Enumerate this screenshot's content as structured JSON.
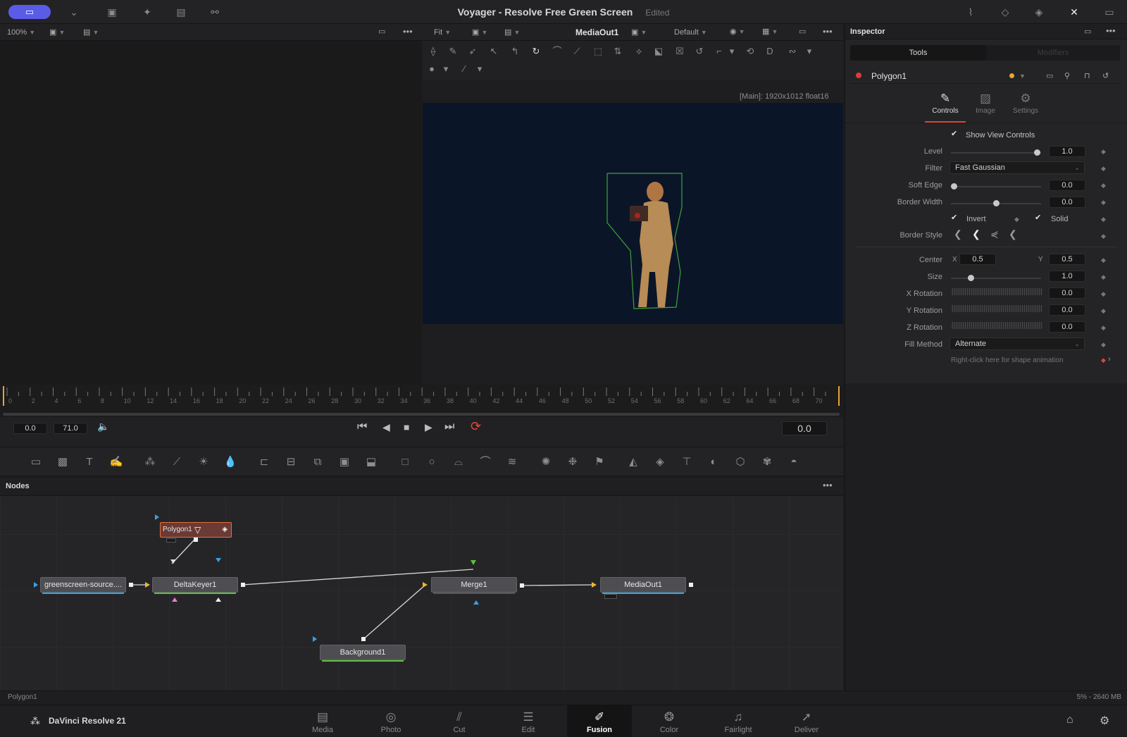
{
  "window": {
    "title": "Voyager - Resolve Free Green Screen",
    "status": "Edited"
  },
  "viewer_left": {
    "zoom": "100%"
  },
  "viewer_right": {
    "fit": "Fit",
    "output": "MediaOut1",
    "lut": "Default",
    "resolution": "[Main]: 1920x1012 float16"
  },
  "inspector": {
    "title": "Inspector",
    "tabs": [
      "Tools",
      "Modifiers"
    ],
    "node_name": "Polygon1",
    "subtabs": [
      "Controls",
      "Image",
      "Settings"
    ],
    "show_view_controls": "Show View Controls",
    "level": {
      "label": "Level",
      "value": "1.0",
      "fraction": 0.95
    },
    "filter": {
      "label": "Filter",
      "value": "Fast Gaussian"
    },
    "soft_edge": {
      "label": "Soft Edge",
      "value": "0.0",
      "fraction": 0.0
    },
    "border_width": {
      "label": "Border Width",
      "value": "0.0",
      "fraction": 0.5
    },
    "invert": "Invert",
    "solid": "Solid",
    "border_style": "Border Style",
    "center": {
      "label": "Center",
      "x_label": "X",
      "x": "0.5",
      "y_label": "Y",
      "y": "0.5"
    },
    "size": {
      "label": "Size",
      "value": "1.0",
      "fraction": 0.2
    },
    "x_rotation": {
      "label": "X Rotation",
      "value": "0.0"
    },
    "y_rotation": {
      "label": "Y Rotation",
      "value": "0.0"
    },
    "z_rotation": {
      "label": "Z Rotation",
      "value": "0.0"
    },
    "fill_method": {
      "label": "Fill Method",
      "value": "Alternate"
    },
    "hint": "Right-click here for shape animation"
  },
  "ruler": {
    "ticks": [
      "0",
      "2",
      "4",
      "6",
      "8",
      "10",
      "12",
      "14",
      "16",
      "18",
      "20",
      "22",
      "24",
      "26",
      "28",
      "30",
      "32",
      "34",
      "36",
      "38",
      "40",
      "42",
      "44",
      "46",
      "48",
      "50",
      "52",
      "54",
      "56",
      "58",
      "60",
      "62",
      "64",
      "66",
      "68",
      "70"
    ]
  },
  "transport": {
    "start": "0.0",
    "end": "71.0",
    "current": "0.0"
  },
  "nodes": {
    "header": "Nodes",
    "items": {
      "polygon": "Polygon1",
      "source": "greenscreen-source....",
      "delta": "DeltaKeyer1",
      "merge": "Merge1",
      "mediaout": "MediaOut1",
      "background": "Background1"
    }
  },
  "status": {
    "left": "Polygon1",
    "right": "5% - 2640 MB"
  },
  "pages": {
    "app": "DaVinci Resolve 21",
    "items": [
      "Media",
      "Photo",
      "Cut",
      "Edit",
      "Fusion",
      "Color",
      "Fairlight",
      "Deliver"
    ],
    "active": "Fusion"
  }
}
